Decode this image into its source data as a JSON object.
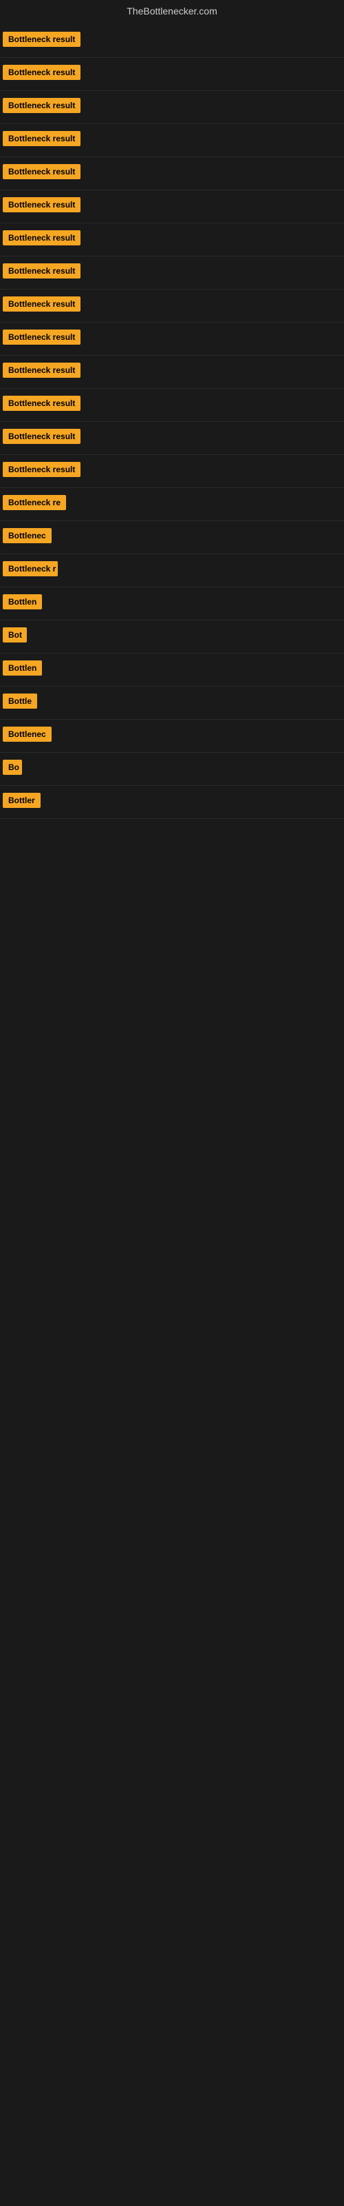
{
  "header": {
    "title": "TheBottlenecker.com"
  },
  "results": [
    {
      "id": 1,
      "label": "Bottleneck result",
      "width": 130
    },
    {
      "id": 2,
      "label": "Bottleneck result",
      "width": 130
    },
    {
      "id": 3,
      "label": "Bottleneck result",
      "width": 130
    },
    {
      "id": 4,
      "label": "Bottleneck result",
      "width": 130
    },
    {
      "id": 5,
      "label": "Bottleneck result",
      "width": 130
    },
    {
      "id": 6,
      "label": "Bottleneck result",
      "width": 130
    },
    {
      "id": 7,
      "label": "Bottleneck result",
      "width": 130
    },
    {
      "id": 8,
      "label": "Bottleneck result",
      "width": 130
    },
    {
      "id": 9,
      "label": "Bottleneck result",
      "width": 130
    },
    {
      "id": 10,
      "label": "Bottleneck result",
      "width": 130
    },
    {
      "id": 11,
      "label": "Bottleneck result",
      "width": 130
    },
    {
      "id": 12,
      "label": "Bottleneck result",
      "width": 130
    },
    {
      "id": 13,
      "label": "Bottleneck result",
      "width": 130
    },
    {
      "id": 14,
      "label": "Bottleneck result",
      "width": 130
    },
    {
      "id": 15,
      "label": "Bottleneck re",
      "width": 100
    },
    {
      "id": 16,
      "label": "Bottlenec",
      "width": 75
    },
    {
      "id": 17,
      "label": "Bottleneck r",
      "width": 80
    },
    {
      "id": 18,
      "label": "Bottlen",
      "width": 60
    },
    {
      "id": 19,
      "label": "Bot",
      "width": 35
    },
    {
      "id": 20,
      "label": "Bottlen",
      "width": 60
    },
    {
      "id": 21,
      "label": "Bottle",
      "width": 52
    },
    {
      "id": 22,
      "label": "Bottlenec",
      "width": 72
    },
    {
      "id": 23,
      "label": "Bo",
      "width": 28
    },
    {
      "id": 24,
      "label": "Bottler",
      "width": 55
    }
  ]
}
